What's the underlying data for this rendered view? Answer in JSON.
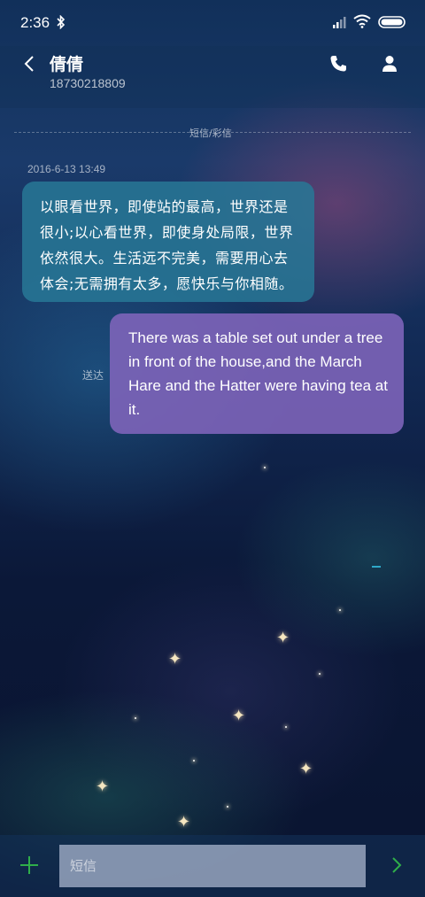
{
  "status_bar": {
    "time": "2:36"
  },
  "header": {
    "contact_name": "倩倩",
    "contact_number": "18730218809"
  },
  "conversation": {
    "divider_label": "短信/彩信",
    "timestamp": "2016-6-13 13:49",
    "messages": [
      {
        "direction": "incoming",
        "text": "以眼看世界，即使站的最高，世界还是很小;以心看世界，即使身处局限，世界依然很大。生活远不完美，需要用心去体会;无需拥有太多，愿快乐与你相随。"
      },
      {
        "direction": "outgoing",
        "text": "There was a table set out under a tree in front of the house,and the March Hare and the Hatter were having tea at it.",
        "status": "送达"
      }
    ]
  },
  "input_bar": {
    "placeholder": "短信"
  },
  "colors": {
    "incoming_bubble": "#2f8097",
    "outgoing_bubble": "#7d64b9",
    "add_icon": "#2fae4a",
    "send_icon": "#2fae4a"
  }
}
